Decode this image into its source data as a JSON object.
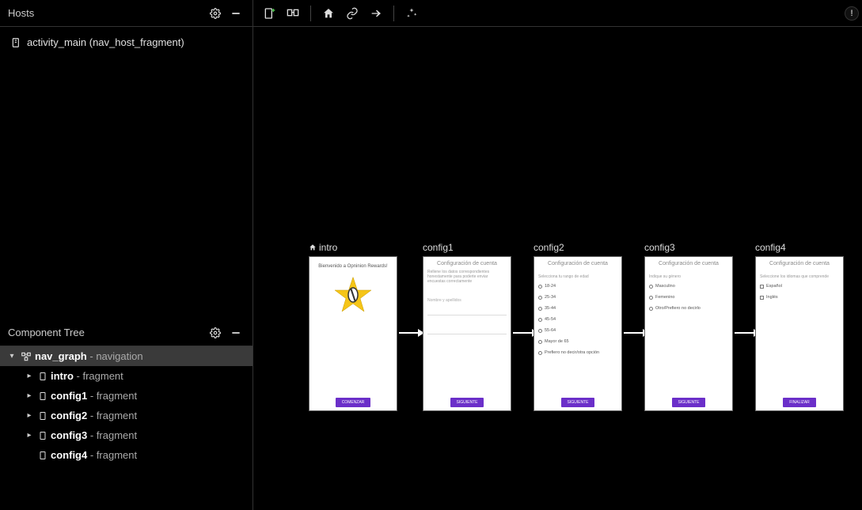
{
  "hosts": {
    "title": "Hosts",
    "item": "activity_main (nav_host_fragment)"
  },
  "component_tree": {
    "title": "Component Tree",
    "root": {
      "name": "nav_graph",
      "type": "navigation"
    },
    "children": [
      {
        "name": "intro",
        "type": "fragment"
      },
      {
        "name": "config1",
        "type": "fragment"
      },
      {
        "name": "config2",
        "type": "fragment"
      },
      {
        "name": "config3",
        "type": "fragment"
      },
      {
        "name": "config4",
        "type": "fragment"
      }
    ]
  },
  "destinations": {
    "intro": {
      "label": "intro",
      "welcome": "Bienvenido a Opninion Rewards!",
      "button": "COMENZAR"
    },
    "config1": {
      "label": "config1",
      "heading": "Configuración de cuenta",
      "desc": "Rellene los datos correspondientes honestamente para poderte enviar encuestas correctamente",
      "field1": "Nombre y apellidos",
      "field2": "",
      "button": "SIGUIENTE"
    },
    "config2": {
      "label": "config2",
      "heading": "Configuración de cuenta",
      "sub": "Selecciona tu rango de edad",
      "options": [
        "18-24",
        "25-34",
        "35-44",
        "45-54",
        "55-64",
        "Mayor de 65",
        "Prefiero no decir/otra opción"
      ],
      "button": "SIGUIENTE"
    },
    "config3": {
      "label": "config3",
      "heading": "Configuración de cuenta",
      "sub": "Indique su género",
      "options": [
        "Masculino",
        "Femenino",
        "Otro/Prefiero no decirlo"
      ],
      "button": "SIGUIENTE"
    },
    "config4": {
      "label": "config4",
      "heading": "Configuración de cuenta",
      "sub": "Seleccione los idiomas que comprende",
      "options": [
        "Español",
        "Inglés"
      ],
      "button": "FINALIZAR"
    }
  }
}
